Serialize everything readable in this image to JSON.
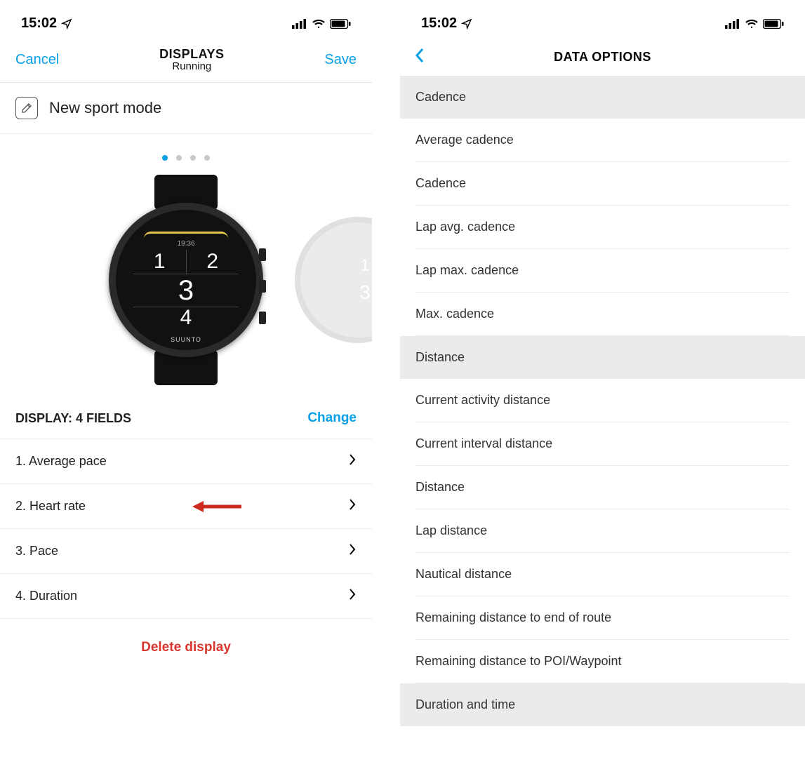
{
  "status": {
    "time": "15:02"
  },
  "left": {
    "nav": {
      "cancel": "Cancel",
      "title": "DISPLAYS",
      "subtitle": "Running",
      "save": "Save"
    },
    "sport_mode_label": "New sport mode",
    "watch": {
      "time": "19:36",
      "n1": "1",
      "n2": "2",
      "n3": "3",
      "n4": "4",
      "brand": "SUUNTO",
      "side1": "1",
      "side2": "3"
    },
    "display_section": {
      "title": "DISPLAY: 4 FIELDS",
      "change": "Change"
    },
    "fields": [
      {
        "label": "1. Average pace"
      },
      {
        "label": "2. Heart rate"
      },
      {
        "label": "3. Pace"
      },
      {
        "label": "4. Duration"
      }
    ],
    "delete_label": "Delete display"
  },
  "right": {
    "title": "DATA OPTIONS",
    "sections": [
      {
        "header": "Cadence",
        "items": [
          "Average cadence",
          "Cadence",
          "Lap avg. cadence",
          "Lap max. cadence",
          "Max. cadence"
        ]
      },
      {
        "header": "Distance",
        "items": [
          "Current activity distance",
          "Current interval distance",
          "Distance",
          "Lap distance",
          "Nautical distance",
          "Remaining distance to end of route",
          "Remaining distance to POI/Waypoint"
        ]
      },
      {
        "header": "Duration and time",
        "items": []
      }
    ]
  }
}
